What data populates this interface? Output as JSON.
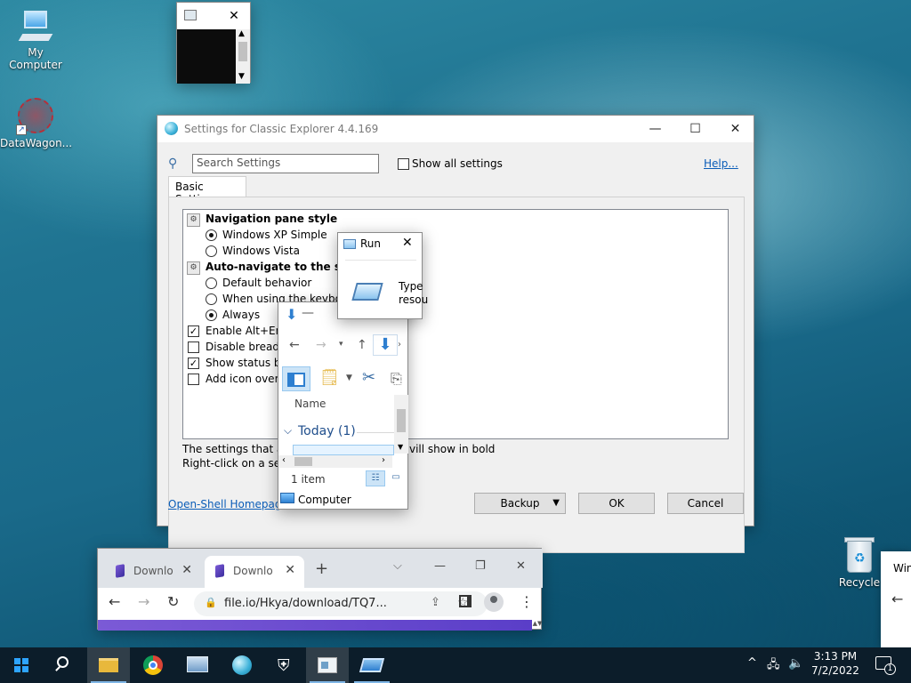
{
  "desktop": {
    "icons": [
      {
        "label": "My Computer",
        "icon": "computer-icon"
      },
      {
        "label": "DataWagon...",
        "icon": "datawagon-icon"
      },
      {
        "label": "Recycle",
        "icon": "recycle-bin-icon"
      }
    ]
  },
  "small_window": {
    "close": "✕"
  },
  "settings": {
    "title": "Settings for Classic Explorer 4.4.169",
    "search_placeholder": "Search Settings",
    "show_all_label": "Show all settings",
    "help_link": "Help...",
    "tab_label": "Basic Settings",
    "groups": [
      {
        "title": "Navigation pane style",
        "options": [
          {
            "label": "Windows XP Simple",
            "selected": true
          },
          {
            "label": "Windows Vista",
            "selected": false
          }
        ]
      },
      {
        "title": "Auto-navigate to the select",
        "options": [
          {
            "label": "Default behavior",
            "selected": false
          },
          {
            "label": "When using the keyboard",
            "selected": false
          },
          {
            "label": "Always",
            "selected": true
          }
        ]
      }
    ],
    "checkboxes": [
      {
        "label": "Enable Alt+Ente",
        "checked": true
      },
      {
        "label": "Disable breadcr",
        "checked": false
      },
      {
        "label": "Show status bar",
        "checked": true
      },
      {
        "label": "Add icon overla",
        "checked": false
      }
    ],
    "footer_line1_left": "The settings that are",
    "footer_line1_right": "vill show in bold",
    "footer_line2": "Right-click on a setti",
    "homepage_link": "Open-Shell Homepage",
    "backup_label": "Backup",
    "ok_label": "OK",
    "cancel_label": "Cancel"
  },
  "run": {
    "title": "Run",
    "text_line1": "Type",
    "text_line2": "resou"
  },
  "explorer": {
    "column_header": "Name",
    "group_label": "Today (1)",
    "status": "1 item",
    "nav_item": "Computer"
  },
  "chrome": {
    "tabs": [
      {
        "title": "Downlo",
        "active": false
      },
      {
        "title": "Downlo",
        "active": true
      }
    ],
    "new_tab": "+",
    "url": "file.io/Hkya/download/TQ7..."
  },
  "notification": {
    "text": "Win"
  },
  "taskbar": {
    "time": "3:13 PM",
    "date": "7/2/2022",
    "notification_count": "1"
  },
  "colors": {
    "link": "#0b5db8",
    "taskbar": "#0c1d2a",
    "chrome_accent": "#7b5ad6"
  }
}
